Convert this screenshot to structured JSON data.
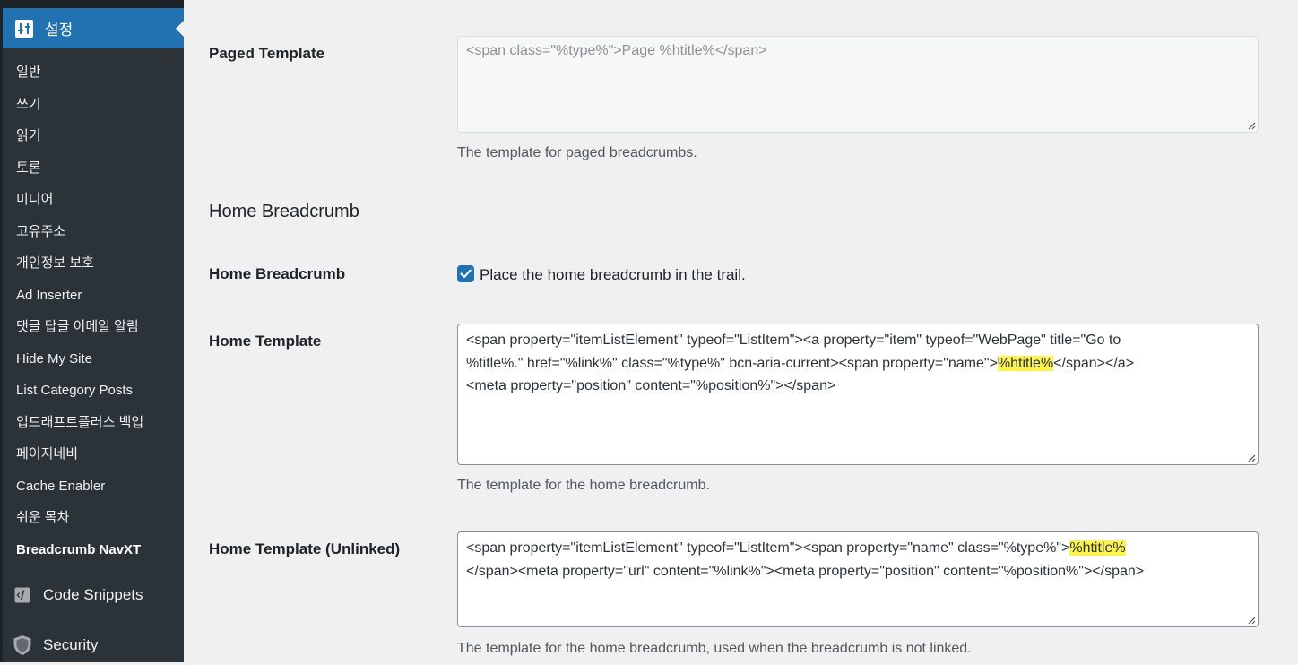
{
  "sidebar": {
    "settings_label": "설정",
    "settings_icon": "settings-sliders-icon",
    "submenu": [
      {
        "label": "일반"
      },
      {
        "label": "쓰기"
      },
      {
        "label": "읽기"
      },
      {
        "label": "토론"
      },
      {
        "label": "미디어"
      },
      {
        "label": "고유주소"
      },
      {
        "label": "개인정보 보호"
      },
      {
        "label": "Ad Inserter"
      },
      {
        "label": "댓글 답글 이메일 알림"
      },
      {
        "label": "Hide My Site"
      },
      {
        "label": "List Category Posts"
      },
      {
        "label": "업드래프트플러스 백업"
      },
      {
        "label": "페이지네비"
      },
      {
        "label": "Cache Enabler"
      },
      {
        "label": "쉬운 목차"
      },
      {
        "label": "Breadcrumb NavXT"
      }
    ],
    "current_item": "Breadcrumb NavXT",
    "code_snippets_label": "Code Snippets",
    "code_snippets_icon": "code-snippets-icon",
    "security_label": "Security",
    "security_icon": "shield-icon"
  },
  "content": {
    "paged_template": {
      "label": "Paged Template",
      "value": "<span class=\"%type%\">Page %htitle%</span>",
      "description": "The template for paged breadcrumbs."
    },
    "home_section_title": "Home Breadcrumb",
    "home_breadcrumb": {
      "label": "Home Breadcrumb",
      "checkbox_label": "Place the home breadcrumb in the trail.",
      "checked": true
    },
    "home_template": {
      "label": "Home Template",
      "line1": "<span property=\"itemListElement\" typeof=\"ListItem\"><a property=\"item\" typeof=\"WebPage\" title=\"Go to",
      "line2_pre": "%title%.\" href=\"%link%\" class=\"%type%\" bcn-aria-current><span property=\"name\">",
      "line2_hl": "%htitle%",
      "line2_post": "</span></a>",
      "line3": "<meta property=\"position\" content=\"%position%\"></span>",
      "description": "The template for the home breadcrumb."
    },
    "home_template_unlinked": {
      "label": "Home Template (Unlinked)",
      "line1_pre": "<span property=\"itemListElement\" typeof=\"ListItem\"><span property=\"name\" class=\"%type%\">",
      "line1_hl": "%htitle%",
      "line2": "</span><meta property=\"url\" content=\"%link%\"><meta property=\"position\" content=\"%position%\"></span>",
      "description": "The template for the home breadcrumb, used when the breadcrumb is not linked."
    }
  },
  "colors": {
    "sidebar_bg": "#2c3338",
    "active_menu_bg": "#2271b1",
    "highlight": "#fff44f",
    "page_bg": "#f0f0f1"
  }
}
